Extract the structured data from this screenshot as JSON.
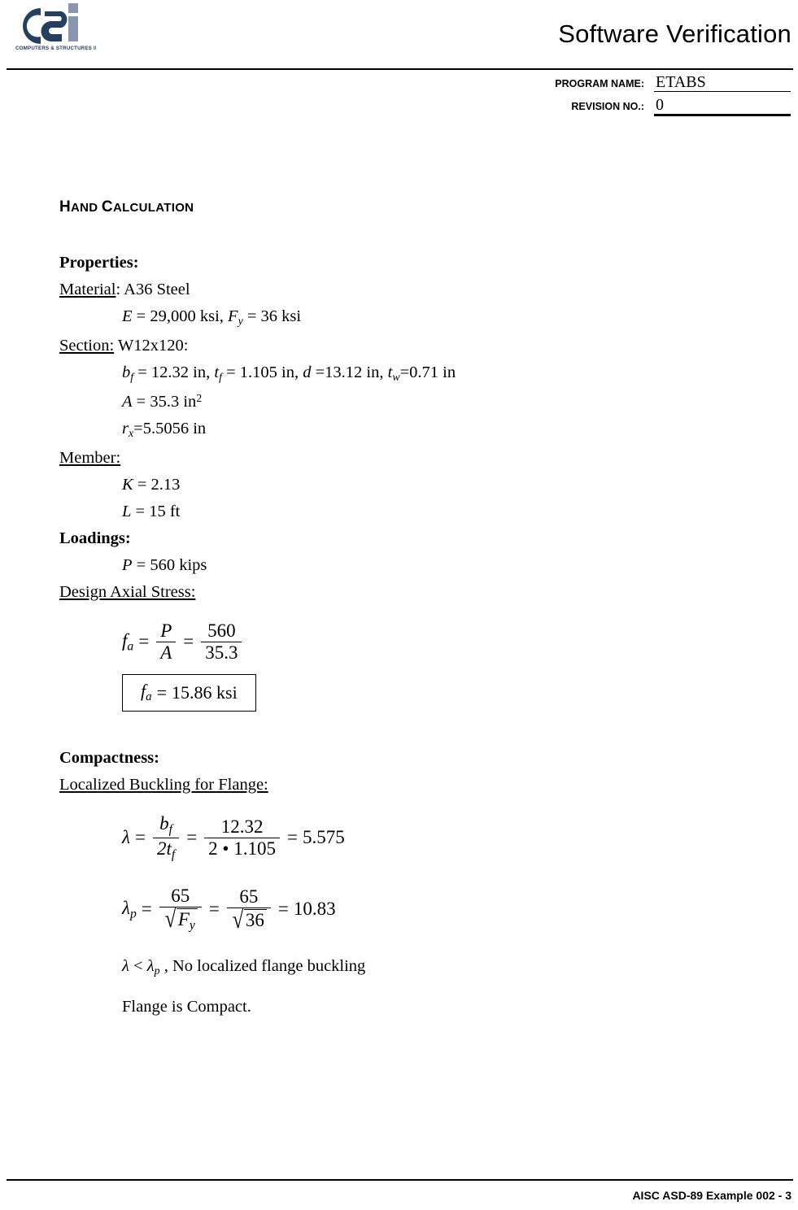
{
  "header": {
    "logo_alt": "Computers & Structures Inc.",
    "logo_wordmark": "COMPUTERS & STRUCTURES INC.",
    "title": "Software Verification",
    "program_name_label": "PROGRAM NAME:",
    "program_name_value": "ETABS",
    "revision_label": "REVISION NO.:",
    "revision_value": "0",
    "logo_dark_color": "#24405f",
    "logo_light_color": "#8a95b1"
  },
  "body": {
    "section_heading": "HAND CALCULATION",
    "section_heading_small": "AND",
    "section_heading_small2": "ALCULATION",
    "properties": {
      "heading": "Properties:",
      "material_label": "Material",
      "material_value": "A36 Steel",
      "E_symbol": "E",
      "E_text": " = 29,000 ksi, ",
      "Fy_symbol": "F",
      "Fy_sub": "y",
      "Fy_text": "  = 36 ksi",
      "section_label": "Section:",
      "section_value": "W12x120:",
      "bf_symbol": "b",
      "bf_sub": "f",
      "bf_text": " = 12.32 in, ",
      "tf_symbol": "t",
      "tf_sub": "f",
      "tf_text": " = 1.105 in, ",
      "d_symbol": "d",
      "d_text": " =13.12 in, ",
      "tw_symbol": "t",
      "tw_sub": "w",
      "tw_text": "=0.71 in",
      "A_symbol": "A",
      "A_text": " = 35.3 in",
      "A_sup": "2",
      "rx_symbol": "r",
      "rx_sub": "x",
      "rx_text": "=5.5056 in"
    },
    "member": {
      "label": "Member:",
      "K_symbol": "K",
      "K_text": " = 2.13",
      "L_symbol": "L",
      "L_text": " = 15 ft"
    },
    "loadings": {
      "heading": "Loadings:",
      "P_symbol": "P",
      "P_text": " = 560 kips"
    },
    "design_axial_stress": {
      "label": "Design Axial Stress:",
      "fa_symbol": "f",
      "fa_sub": "a",
      "eq_sign_1": "=",
      "num_1": "P",
      "den_1": "A",
      "eq_sign_2": "=",
      "num_2": "560",
      "den_2": "35.3",
      "result_symbol": "f",
      "result_sub": "a",
      "result_eq": "=",
      "result_value": "15.86",
      "result_unit": "ksi"
    },
    "compactness": {
      "heading": "Compactness:",
      "flange_label": "Localized Buckling for Flange:",
      "lambda_symbol": "λ",
      "lambda_eq1": "=",
      "lambda_num1": "b",
      "lambda_num1_sub": "f",
      "lambda_den1": "2t",
      "lambda_den1_sub": "f",
      "lambda_eq2": "=",
      "lambda_num2": "12.32",
      "lambda_den2": "2 • 1.105",
      "lambda_eq3": "=",
      "lambda_value": "5.575",
      "lambdap_symbol": "λ",
      "lambdap_sub": "p",
      "lambdap_eq1": "=",
      "lambdap_num1": "65",
      "lambdap_den1_sym": "F",
      "lambdap_den1_sub": "y",
      "lambdap_eq2": "=",
      "lambdap_num2": "65",
      "lambdap_den2": "36",
      "lambdap_eq3": "=",
      "lambdap_value": "10.83",
      "compare_lambda": "λ",
      "compare_op": " < ",
      "compare_lambdap": "λ",
      "compare_lambdap_sub": "p",
      "compare_text": " , No localized flange buckling",
      "conclusion": "Flange is Compact."
    }
  },
  "footer": {
    "text": "AISC ASD-89 Example 002 - 3"
  }
}
